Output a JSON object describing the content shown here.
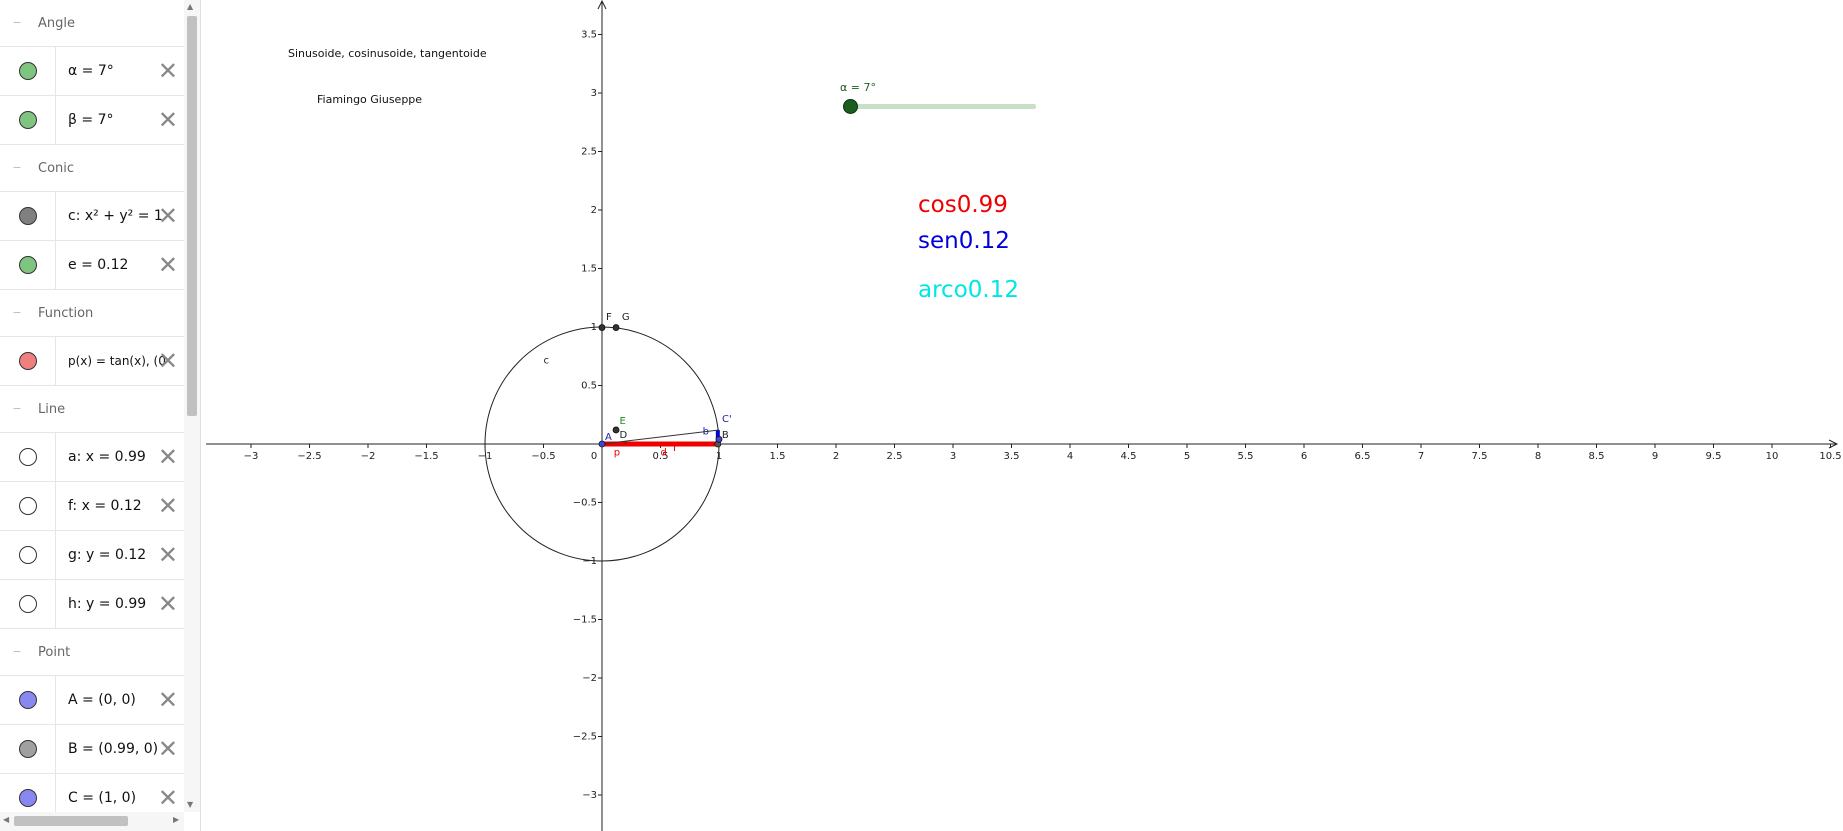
{
  "algebra": {
    "groups": [
      {
        "title": "Angle"
      },
      {
        "title": "Conic"
      },
      {
        "title": "Function"
      },
      {
        "title": "Line"
      },
      {
        "title": "Point"
      }
    ],
    "items": {
      "alpha": {
        "expr": "α = 7°",
        "color": "#7fc47f"
      },
      "beta": {
        "expr": "β = 7°",
        "color": "#7fc47f"
      },
      "c": {
        "expr": "c: x² + y² = 1",
        "color": "#808080"
      },
      "e": {
        "expr": "e = 0.12",
        "color": "#7fc47f"
      },
      "p": {
        "expr": "p(x) = tan(x), (0",
        "color": "#f08080"
      },
      "a": {
        "expr": "a: x = 0.99",
        "color": "#ffffff"
      },
      "f": {
        "expr": "f: x = 0.12",
        "color": "#ffffff"
      },
      "g": {
        "expr": "g: y = 0.12",
        "color": "#ffffff"
      },
      "h": {
        "expr": "h: y = 0.99",
        "color": "#ffffff"
      },
      "A": {
        "expr": "A = (0, 0)",
        "color": "#8888f0"
      },
      "B": {
        "expr": "B = (0.99, 0)",
        "color": "#a0a0a0"
      },
      "C": {
        "expr": "C = (1, 0)",
        "color": "#8888f0"
      }
    }
  },
  "graphics": {
    "title": "Sinusoide, cosinusoide, tangentoide",
    "author": "Fiamingo Giuseppe",
    "slider_label": "α = 7°",
    "slider_value_fraction": 0.0,
    "cos_text": "cos0.99",
    "sen_text": "sen0.12",
    "arco_text": "arco0.12",
    "colors": {
      "cos": "#ee0000",
      "sen": "#0000dd",
      "arco": "#00e5e5",
      "slider": "#1b5e20"
    },
    "x_ticks": [
      "−3",
      "−2.5",
      "−2",
      "−1.5",
      "−1",
      "−0.5",
      "0",
      "0.5",
      "1",
      "1.5",
      "2",
      "2.5",
      "3",
      "3.5",
      "4",
      "4.5",
      "5",
      "5.5",
      "6",
      "6.5",
      "7",
      "7.5",
      "8",
      "8.5",
      "9",
      "9.5",
      "10",
      "10.5"
    ],
    "y_ticks": [
      "3.5",
      "3",
      "2.5",
      "2",
      "1.5",
      "1",
      "0.5",
      "−0.5",
      "−1",
      "−1.5",
      "−2",
      "−2.5",
      "−3"
    ],
    "point_labels": {
      "A": "A",
      "B": "B",
      "C": "C",
      "D": "D",
      "E": "E",
      "F": "F",
      "G": "G",
      "c": "c",
      "b": "b",
      "p": "p",
      "d": "d",
      "cprime": "C'"
    }
  }
}
